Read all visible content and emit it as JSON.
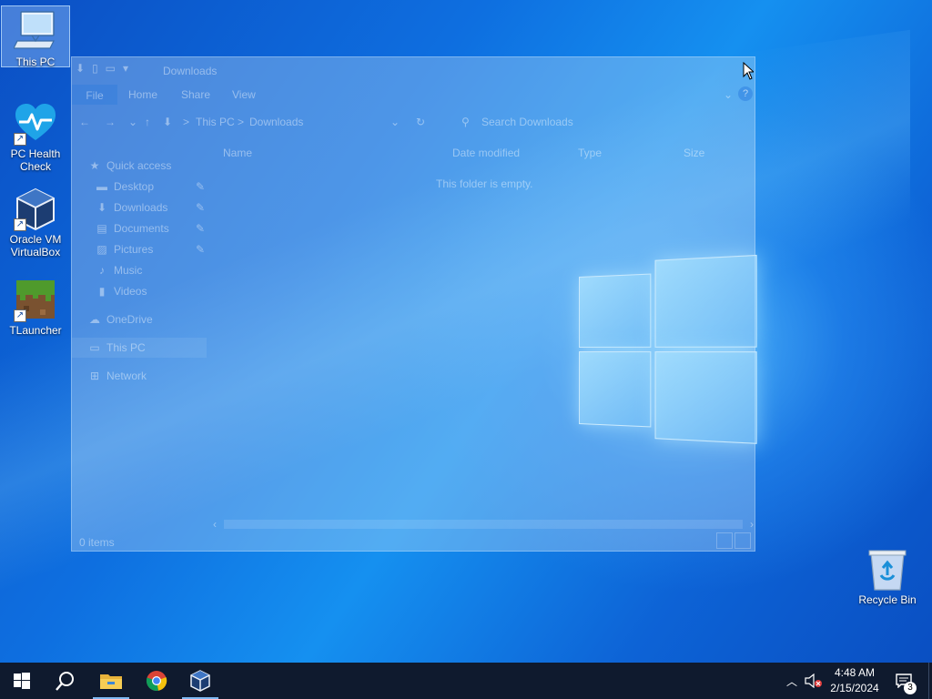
{
  "desktop": {
    "icons": [
      {
        "label": "This PC",
        "icon": "computer-icon"
      },
      {
        "label": "PC Health Check",
        "icon": "pc-health-check-icon"
      },
      {
        "label": "Oracle VM VirtualBox",
        "icon": "virtualbox-icon"
      },
      {
        "label": "TLauncher",
        "icon": "tlauncher-icon"
      },
      {
        "label": "Recycle Bin",
        "icon": "recycle-bin-icon"
      }
    ]
  },
  "explorer": {
    "title": "Downloads",
    "ribbon_tabs": [
      "File",
      "Home",
      "Share",
      "View"
    ],
    "address_path": [
      "This PC",
      "Downloads"
    ],
    "address_separator": ">",
    "search_placeholder": "Search Downloads",
    "columns": [
      "Name",
      "Date modified",
      "Type",
      "Size"
    ],
    "empty_message": "This folder is empty.",
    "nav": {
      "quick_access": "Quick access",
      "quick_items": [
        "Desktop",
        "Downloads",
        "Documents",
        "Pictures",
        "Music",
        "Videos"
      ],
      "onedrive": "OneDrive",
      "this_pc": "This PC",
      "network": "Network"
    },
    "status": "0 items"
  },
  "taskbar": {
    "apps": [
      "start-icon",
      "search-icon",
      "file-explorer-icon",
      "chrome-icon",
      "virtualbox-icon"
    ],
    "time": "4:48 AM",
    "date": "2/15/2024",
    "notification_count": "3"
  },
  "colors": {
    "taskbar_bg": "#0f1a2e",
    "accent": "#0a62d0"
  }
}
